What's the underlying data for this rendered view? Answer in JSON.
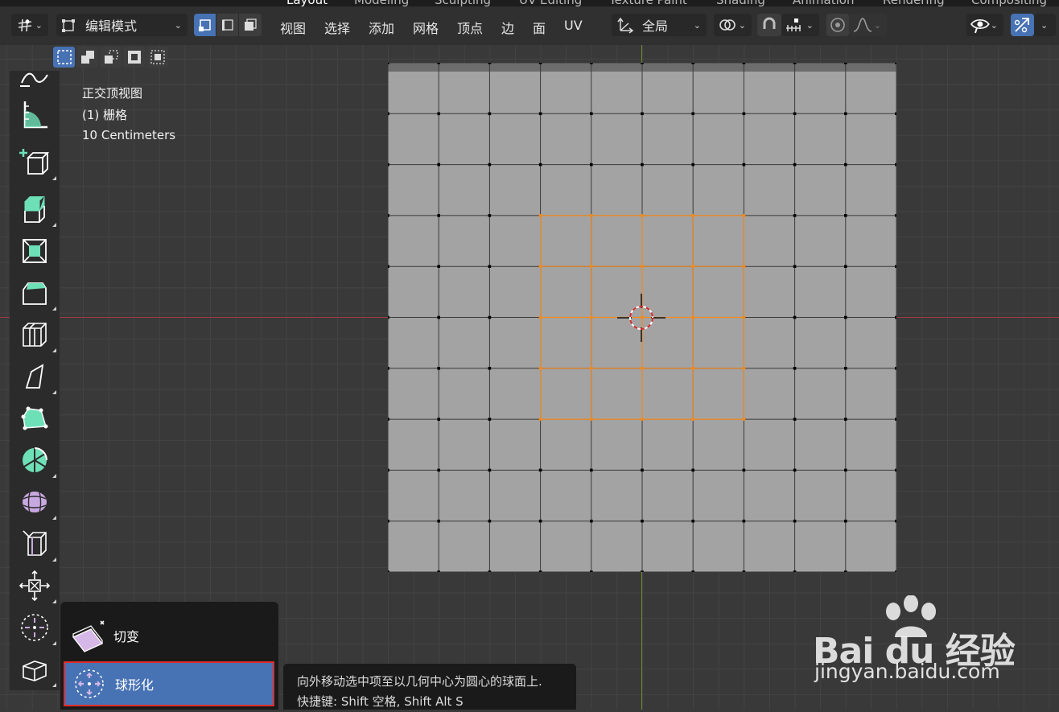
{
  "workspace_tabs": [
    "Layout",
    "Modeling",
    "Sculpting",
    "UV Editing",
    "Texture Paint",
    "Shading",
    "Animation",
    "Rendering",
    "Compositing"
  ],
  "header": {
    "mode_label": "编辑模式",
    "menus": [
      "视图",
      "选择",
      "添加",
      "网格",
      "顶点",
      "边",
      "面",
      "UV"
    ],
    "transform_orientation": "全局"
  },
  "viewport": {
    "view_name": "正交顶视图",
    "object_label": "(1) 栅格",
    "scale_label": "10 Centimeters"
  },
  "popup": {
    "items": [
      {
        "label": "切变",
        "icon": "shear-icon"
      },
      {
        "label": "球形化",
        "icon": "to-sphere-icon",
        "selected": true
      }
    ]
  },
  "tooltip": {
    "description": "向外移动选中项至以几何中心为圆心的球面上.",
    "shortcut": "快捷键: Shift 空格, Shift Alt S"
  },
  "watermark": {
    "logo": "Bai du 经验",
    "url": "jingyan.baidu.com"
  },
  "colors": {
    "accent": "#4772b3",
    "selection": "#f28a1e",
    "highlight_border": "#e22b2b",
    "mesh_face": "#a3a3a3"
  }
}
